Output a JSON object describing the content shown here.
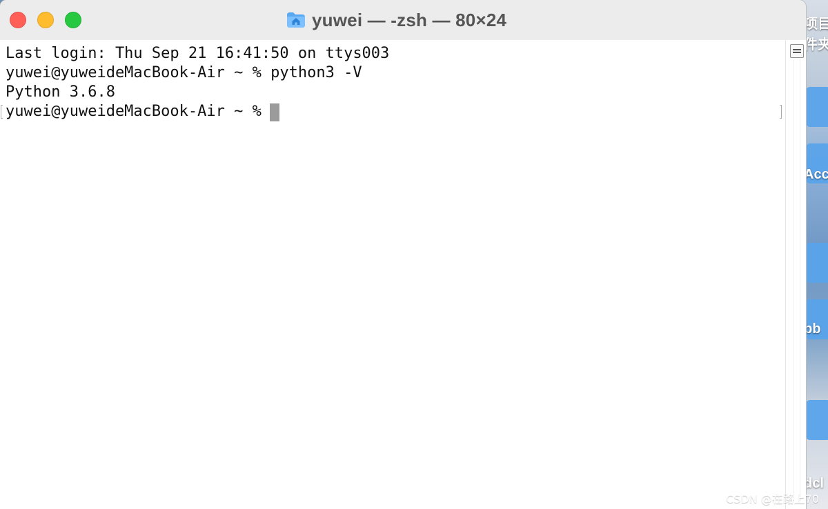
{
  "window": {
    "title": "yuwei — -zsh — 80×24",
    "icon": "home-folder-icon"
  },
  "terminal": {
    "lines": [
      "Last login: Thu Sep 21 16:41:50 on ttys003",
      "yuwei@yuweideMacBook-Air ~ % python3 -V",
      "Python 3.6.8"
    ],
    "current_prompt": "yuwei@yuweideMacBook-Air ~ %"
  },
  "desktop": {
    "labels": [
      "项目",
      "件夹",
      "Acc",
      "bb",
      "dcl"
    ]
  },
  "watermark": {
    "text": "CSDN @在路上70"
  },
  "colors": {
    "close": "#ff5f57",
    "minimize": "#febc2e",
    "zoom": "#28c840",
    "cursor": "#9b9b9b",
    "folder": "#4da3ee"
  }
}
